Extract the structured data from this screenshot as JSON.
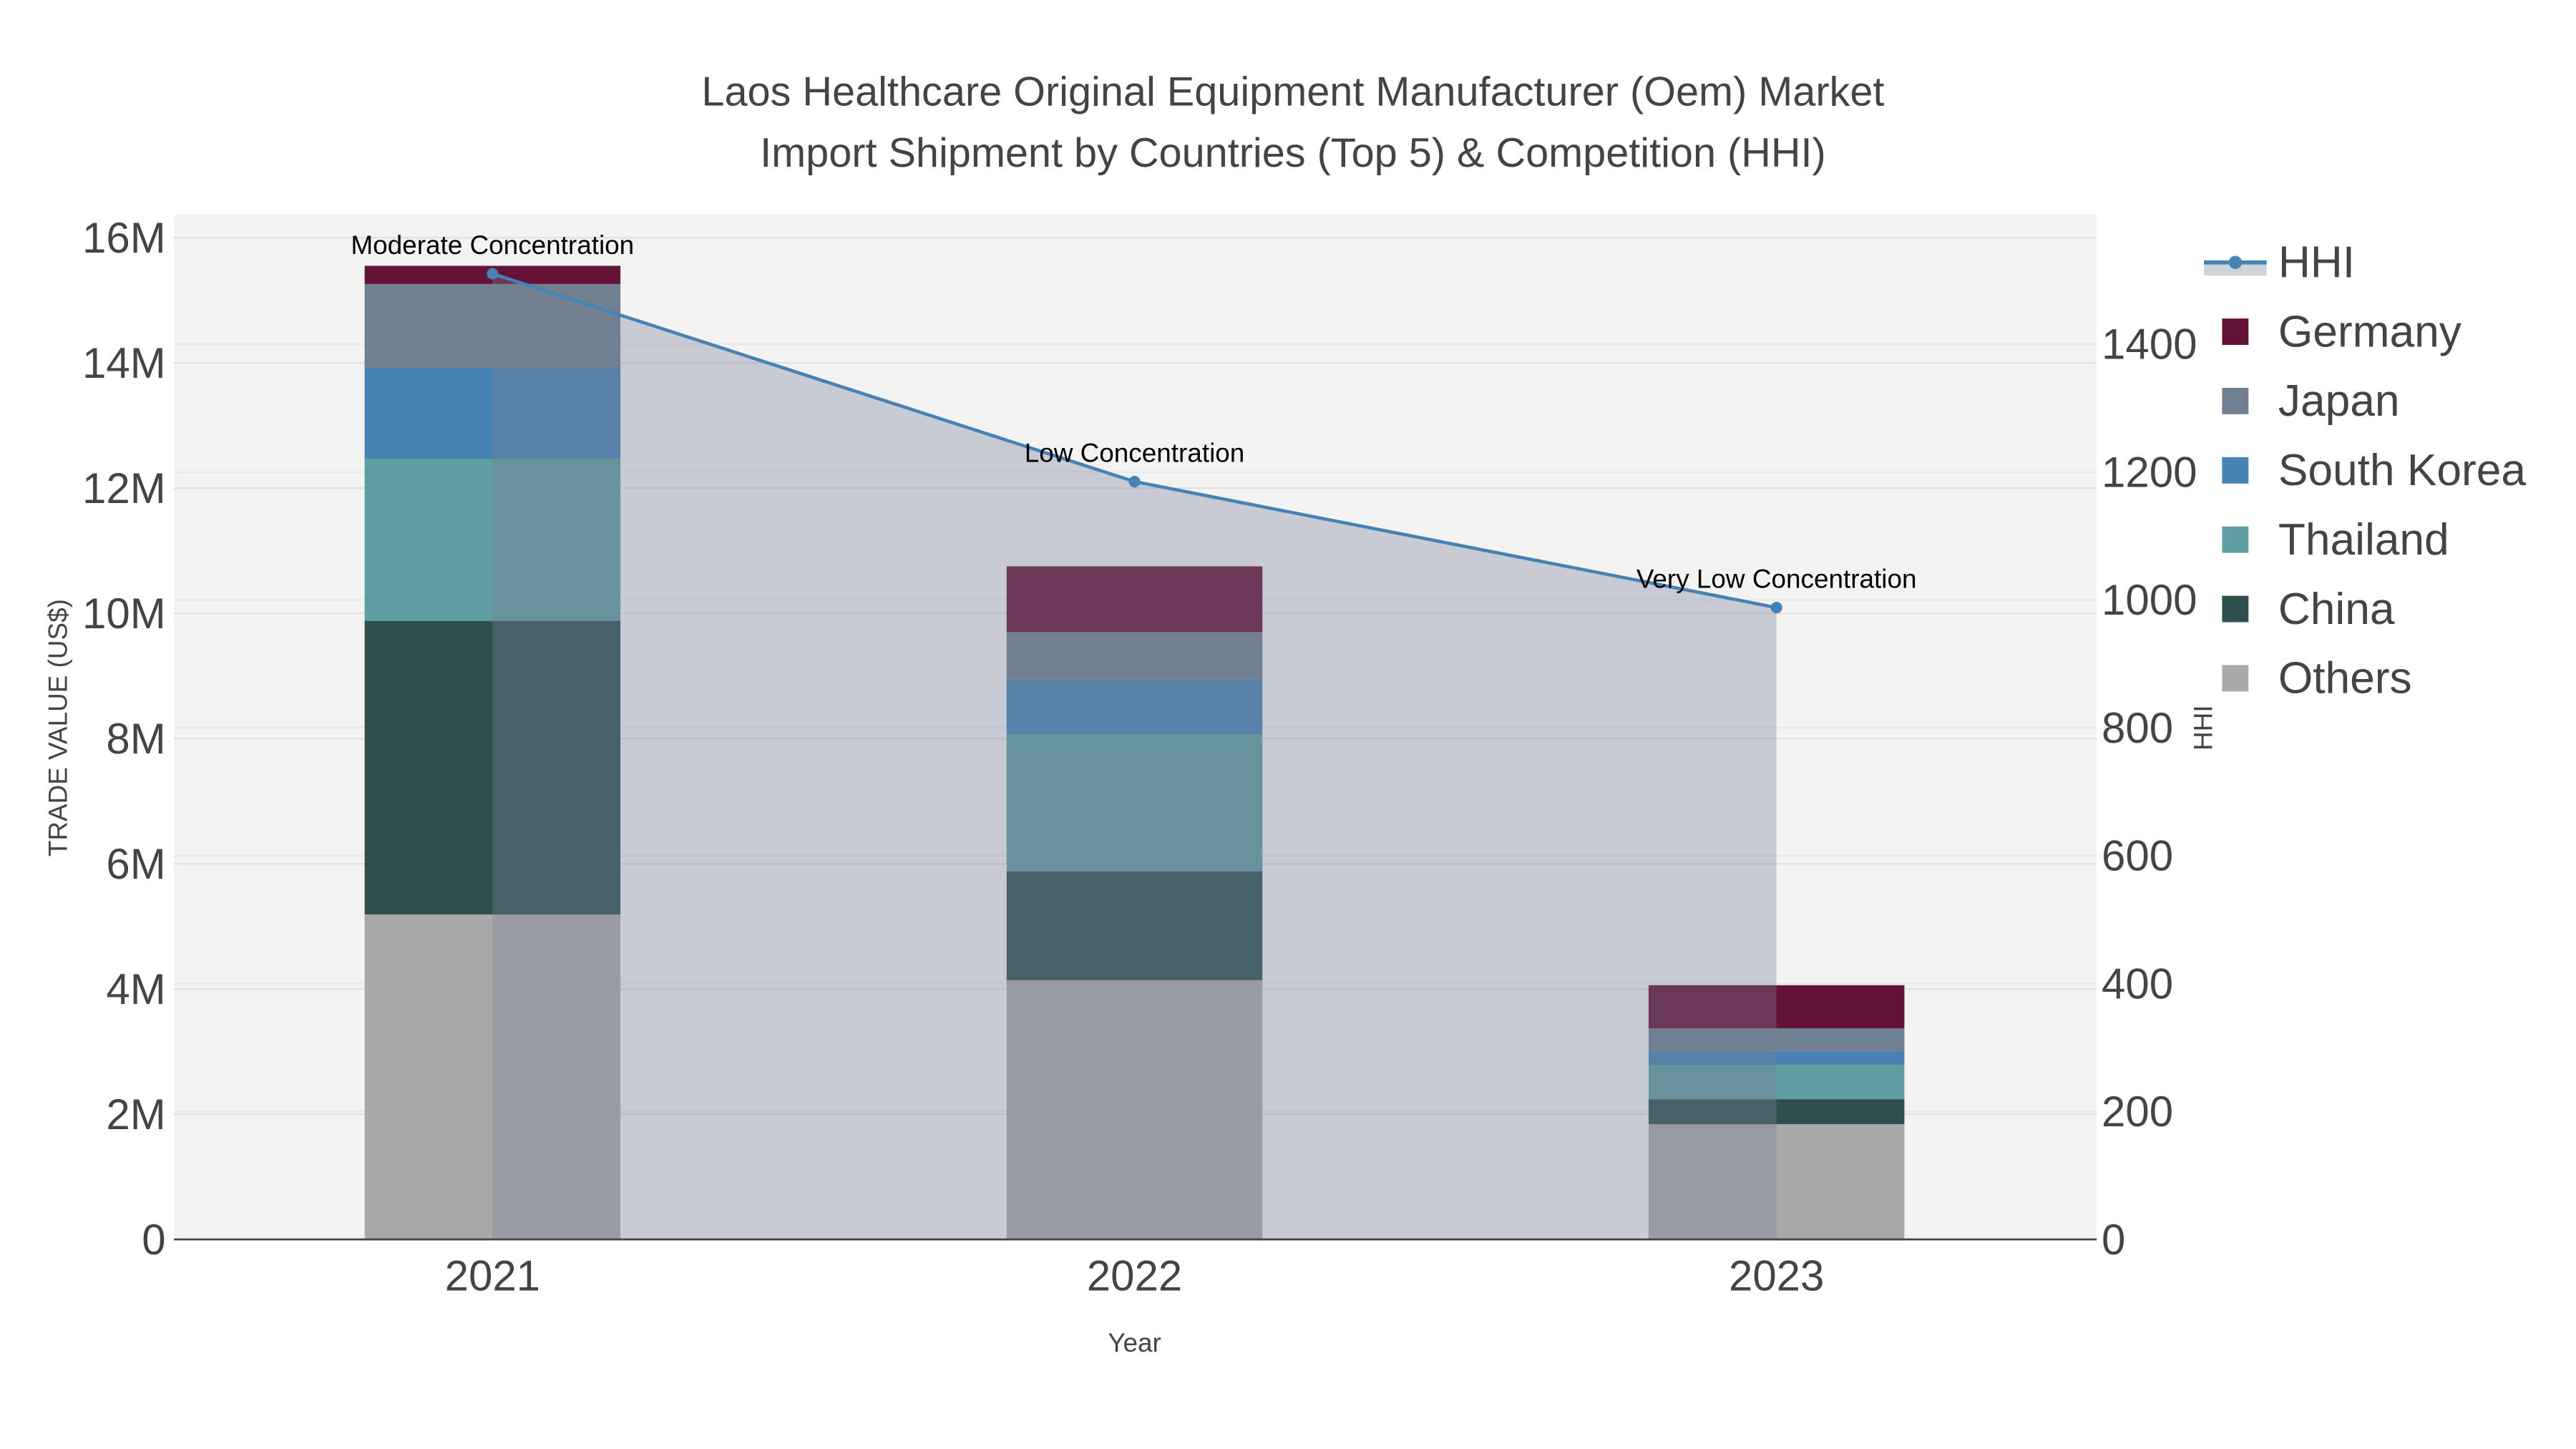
{
  "chart_data": {
    "type": "bar",
    "stacked": true,
    "title_lines": [
      "Laos Healthcare Original Equipment Manufacturer (Oem) Market",
      "Import Shipment by Countries (Top 5) & Competition (HHI)"
    ],
    "xlabel": "Year",
    "ylabel": "TRADE VALUE (US$)",
    "y2label": "HHI",
    "categories": [
      "2021",
      "2022",
      "2023"
    ],
    "ylim": [
      0,
      16000000
    ],
    "y_ticks": [
      0,
      2000000,
      4000000,
      6000000,
      8000000,
      10000000,
      12000000,
      14000000,
      16000000
    ],
    "y_tick_labels": [
      "0",
      "2M",
      "4M",
      "6M",
      "8M",
      "10M",
      "12M",
      "14M",
      "16M"
    ],
    "y2lim": [
      0,
      1600
    ],
    "y2_ticks": [
      0,
      200,
      400,
      600,
      800,
      1000,
      1200,
      1400
    ],
    "y2_tick_labels": [
      "0",
      "200",
      "400",
      "600",
      "800",
      "1000",
      "1200",
      "1400"
    ],
    "grid": true,
    "legend_position": "right",
    "series": [
      {
        "name": "Others",
        "color": "#A9A9A9",
        "values": [
          5190000,
          4140000,
          1840000
        ]
      },
      {
        "name": "China",
        "color": "#2F4F4F",
        "values": [
          4690000,
          1740000,
          400000
        ]
      },
      {
        "name": "Thailand",
        "color": "#5F9EA0",
        "values": [
          2590000,
          2190000,
          550000
        ]
      },
      {
        "name": "South Korea",
        "color": "#4682B4",
        "values": [
          1450000,
          870000,
          210000
        ]
      },
      {
        "name": "Japan",
        "color": "#708090",
        "values": [
          1340000,
          760000,
          370000
        ]
      },
      {
        "name": "Germany",
        "color": "#641236",
        "values": [
          290000,
          1050000,
          690000
        ]
      }
    ],
    "hhi": {
      "name": "HHI",
      "color": "#4682B4",
      "values": [
        1510,
        1185,
        988
      ]
    },
    "annotations": [
      "Moderate Concentration",
      "Low Concentration",
      "Very Low Concentration"
    ],
    "legend_order": [
      "HHI",
      "Germany",
      "Japan",
      "South Korea",
      "Thailand",
      "China",
      "Others"
    ]
  }
}
